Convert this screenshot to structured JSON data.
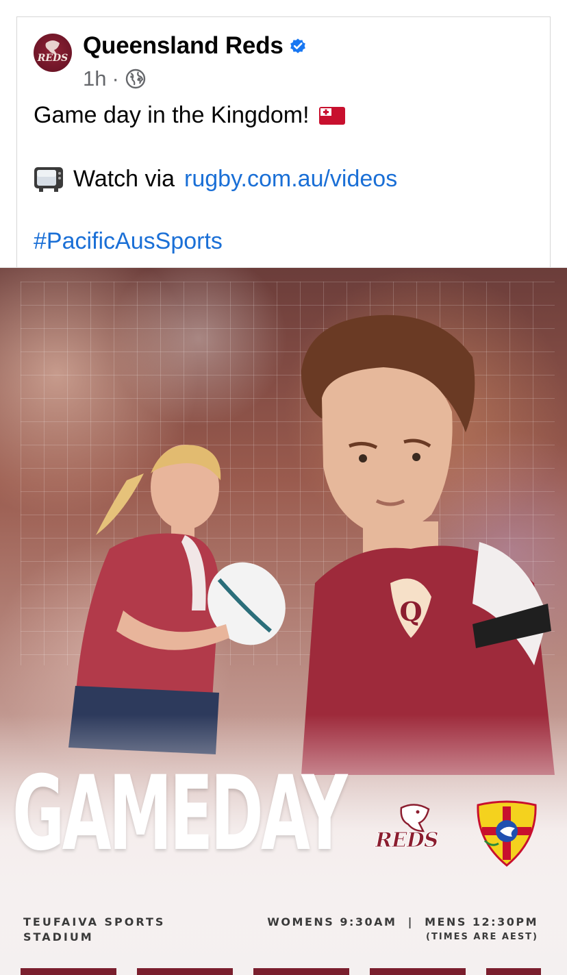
{
  "post": {
    "author": "Queensland Reds",
    "time": "1h",
    "separator": "·",
    "line1": "Game day in the Kingdom!",
    "line2_prefix": "Watch via",
    "line2_link": "rugby.com.au/videos",
    "hashtag": "#PacificAusSports"
  },
  "graphic": {
    "headline": "GAMEDAY",
    "reds_wordmark": "REDS",
    "venue_line1": "TEUFAIVA SPORTS",
    "venue_line2": "STADIUM",
    "times": "WOMENS 9:30AM  |  MENS 12:30PM",
    "times_note": "(TIMES ARE AEST)"
  },
  "icons": {
    "avatar": "reds-logo-icon",
    "verified": "verified-badge-icon",
    "privacy": "globe-icon",
    "flag": "tonga-flag-icon",
    "tv": "television-icon"
  },
  "colors": {
    "link": "#1a6fd6",
    "verified": "#1877f2",
    "reds_maroon": "#8b1d2f",
    "meta_gray": "#65676b"
  }
}
